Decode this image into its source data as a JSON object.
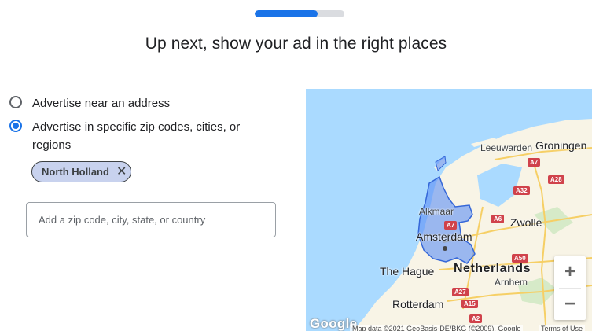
{
  "progress": {
    "fraction": 0.7
  },
  "header": {
    "title": "Up next, show your ad in the right places"
  },
  "options": [
    {
      "label": "Advertise near an address",
      "selected": false
    },
    {
      "label": "Advertise in specific zip codes, cities, or regions",
      "selected": true
    }
  ],
  "chip": {
    "label": "North Holland",
    "close_glyph": "✕"
  },
  "zip_input": {
    "placeholder": "Add a zip code, city, state, or country",
    "value": ""
  },
  "map": {
    "places": {
      "leeuwarden": "Leeuwarden",
      "groningen": "Groningen",
      "alkmaar": "Alkmaar",
      "amsterdam": "Amsterdam",
      "zwolle": "Zwolle",
      "the_hague": "The Hague",
      "netherlands": "Netherlands",
      "arnhem": "Arnhem",
      "rotterdam": "Rotterdam"
    },
    "roads": [
      "A7",
      "A28",
      "A32",
      "A6",
      "A50",
      "A7",
      "A27",
      "A15",
      "A2"
    ],
    "zoom_in": "+",
    "zoom_out": "−",
    "logo": "Google",
    "attribution": "Map data ©2021 GeoBasis-DE/BKG (©2009), Google",
    "terms": "Terms of Use",
    "colors": {
      "water": "#aadaff",
      "land": "#f8f4e6",
      "region": "#5b8ef5"
    }
  }
}
